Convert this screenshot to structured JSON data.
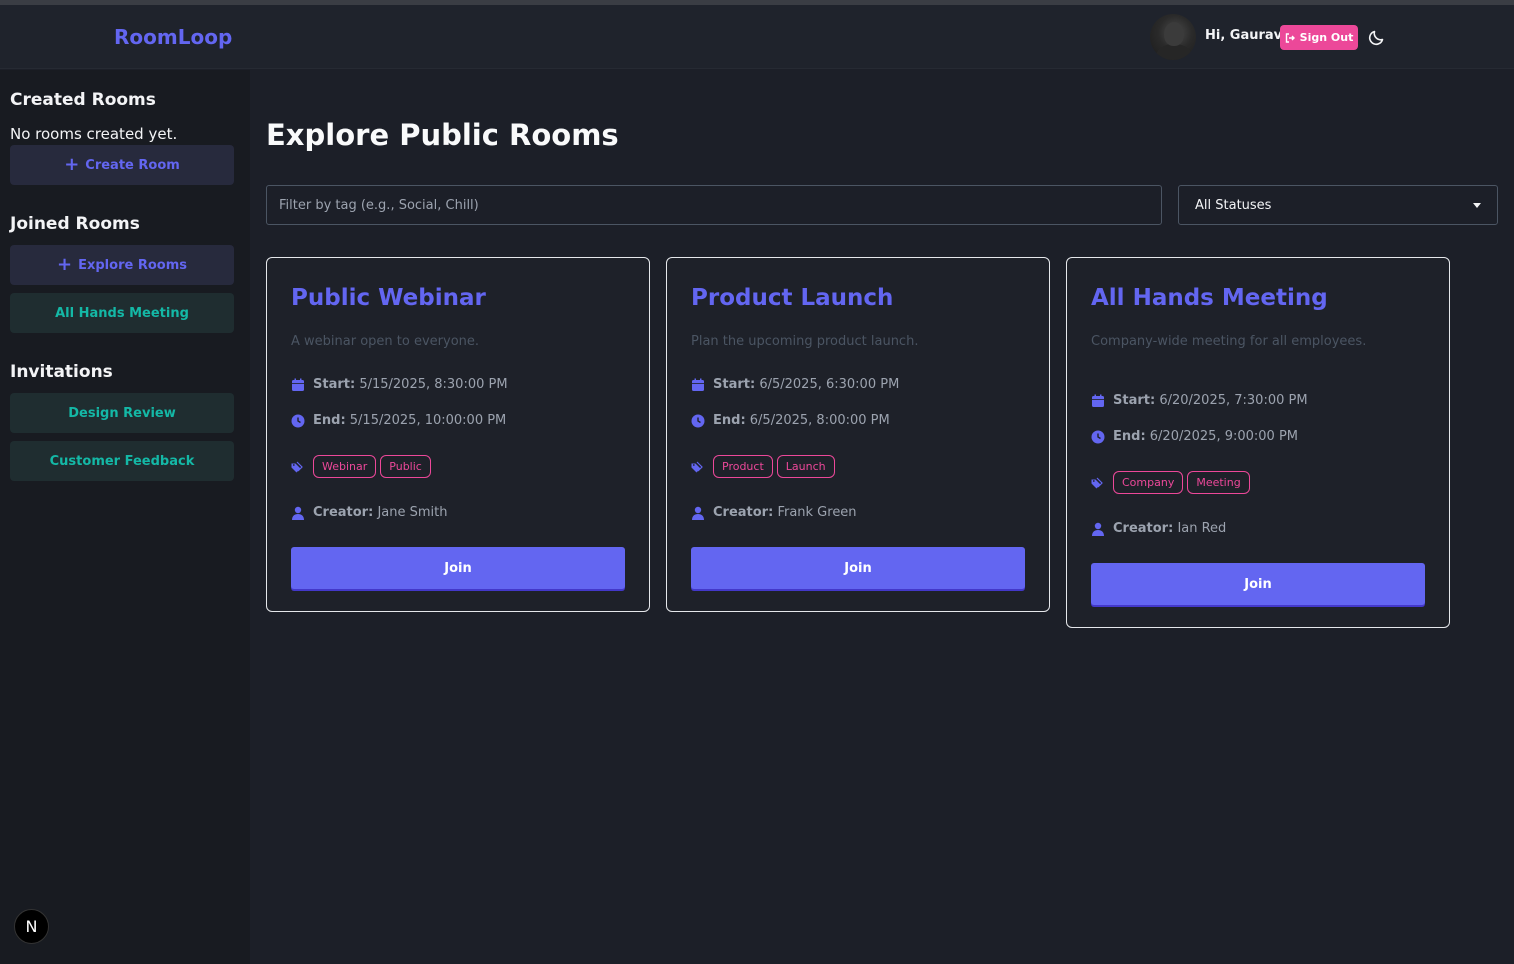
{
  "app": {
    "name": "RoomLoop"
  },
  "header": {
    "greeting": "Hi, Gaurav",
    "signout_label": "Sign Out"
  },
  "sidebar": {
    "created_heading": "Created Rooms",
    "created_empty": "No rooms created yet.",
    "create_room_label": "Create Room",
    "joined_heading": "Joined Rooms",
    "explore_label": "Explore Rooms",
    "joined_rooms": [
      "All Hands Meeting"
    ],
    "invitations_heading": "Invitations",
    "invitations": [
      "Design Review",
      "Customer Feedback"
    ]
  },
  "main": {
    "title": "Explore Public Rooms",
    "filter_placeholder": "Filter by tag (e.g., Social, Chill)",
    "status_value": "All Statuses"
  },
  "labels": {
    "start": "Start:",
    "end": "End:",
    "creator": "Creator:",
    "join": "Join"
  },
  "rooms": [
    {
      "title": "Public Webinar",
      "description": "A webinar open to everyone.",
      "start": "5/15/2025, 8:30:00 PM",
      "end": "5/15/2025, 10:00:00 PM",
      "tags": [
        "Webinar",
        "Public"
      ],
      "creator": "Jane Smith"
    },
    {
      "title": "Product Launch",
      "description": "Plan the upcoming product launch.",
      "start": "6/5/2025, 6:30:00 PM",
      "end": "6/5/2025, 8:00:00 PM",
      "tags": [
        "Product",
        "Launch"
      ],
      "creator": "Frank Green"
    },
    {
      "title": "All Hands Meeting",
      "description": "Company-wide meeting for all employees.",
      "start": "6/20/2025, 7:30:00 PM",
      "end": "6/20/2025, 9:00:00 PM",
      "tags": [
        "Company",
        "Meeting"
      ],
      "creator": "Ian Red"
    }
  ],
  "colors": {
    "accent": "#6366f1",
    "pink": "#ec4899",
    "teal": "#14b8a6"
  },
  "badge": {
    "letter": "N"
  }
}
